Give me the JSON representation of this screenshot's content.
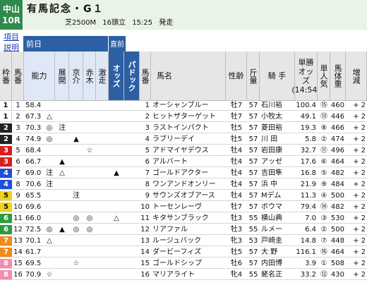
{
  "header": {
    "venue": "中山",
    "race_no": "10R",
    "race_name": "有馬記念・G１",
    "course": "芝2500M",
    "runners": "16頭立",
    "post_time": "15:25",
    "post_label": "発走"
  },
  "side": {
    "items_label": "項目",
    "help_label": "説明"
  },
  "columns": {
    "prev_day": "前日",
    "before": "直前",
    "waku": "枠番",
    "uma": "馬番",
    "nouryoku": "能力",
    "tenkai": "展開",
    "kyou": "京介",
    "akagi": "赤木",
    "gekisou": "激走",
    "odds": "オッズ",
    "paddock": "パドック",
    "uma2": "馬番",
    "horse_name": "馬名",
    "sex_age": "性齢",
    "weight": "斤量",
    "jockey": "騎 手",
    "win_odds": "単勝オッズ",
    "odds_time": "(14:54)",
    "popularity": "単人気",
    "body_weight": "馬体重",
    "change": "増減"
  },
  "rows": [
    {
      "waku": "1",
      "uma": "1",
      "score": "58.4",
      "tenkai": "",
      "kyou": "",
      "akagi": "",
      "gekisou": "",
      "odds_mark": "",
      "paddock": "",
      "name": "オーシャンブルー",
      "sex": "牡7",
      "wt": "57",
      "jockey": "石川裕",
      "odds": "100.4",
      "pop": "⑮",
      "bw": "460",
      "chg": "+ 2"
    },
    {
      "waku": "1",
      "uma": "2",
      "score": "67.3",
      "tenkai": "△",
      "kyou": "",
      "akagi": "",
      "gekisou": "",
      "odds_mark": "",
      "paddock": "",
      "name": "ヒットザターゲット",
      "sex": "牡7",
      "wt": "57",
      "jockey": "小牧太",
      "odds": "49.1",
      "pop": "⑬",
      "bw": "446",
      "chg": "+ 2"
    },
    {
      "waku": "2",
      "uma": "3",
      "score": "70.3",
      "tenkai": "◎",
      "kyou": "注",
      "akagi": "",
      "gekisou": "",
      "odds_mark": "",
      "paddock": "",
      "name": "ラストインパクト",
      "sex": "牡5",
      "wt": "57",
      "jockey": "菱田裕",
      "odds": "19.3",
      "pop": "⑧",
      "bw": "466",
      "chg": "+ 2"
    },
    {
      "waku": "2",
      "uma": "4",
      "score": "74.9",
      "tenkai": "◎",
      "kyou": "",
      "akagi": "▲",
      "gekisou": "",
      "odds_mark": "",
      "paddock": "",
      "name": "ラブリーデイ",
      "sex": "牡5",
      "wt": "57",
      "jockey": "川 田",
      "odds": "5.8",
      "pop": "②",
      "bw": "474",
      "chg": "+ 2"
    },
    {
      "waku": "3",
      "uma": "5",
      "score": "68.4",
      "tenkai": "",
      "kyou": "",
      "akagi": "",
      "gekisou": "☆",
      "odds_mark": "",
      "paddock": "",
      "name": "アドマイヤデウス",
      "sex": "牡4",
      "wt": "57",
      "jockey": "岩田康",
      "odds": "32.7",
      "pop": "⑪",
      "bw": "496",
      "chg": "+ 2"
    },
    {
      "waku": "3",
      "uma": "6",
      "score": "66.7",
      "tenkai": "",
      "kyou": "▲",
      "akagi": "",
      "gekisou": "",
      "odds_mark": "",
      "paddock": "",
      "name": "アルバート",
      "sex": "牡4",
      "wt": "57",
      "jockey": "アッゼ",
      "odds": "17.6",
      "pop": "⑥",
      "bw": "464",
      "chg": "+ 2"
    },
    {
      "waku": "4",
      "uma": "7",
      "score": "69.0",
      "tenkai": "注",
      "kyou": "△",
      "akagi": "",
      "gekisou": "",
      "odds_mark": "▲",
      "paddock": "",
      "name": "ゴールドアクター",
      "sex": "牡4",
      "wt": "57",
      "jockey": "吉田隼",
      "odds": "16.8",
      "pop": "⑤",
      "bw": "482",
      "chg": "+ 2"
    },
    {
      "waku": "4",
      "uma": "8",
      "score": "70.6",
      "tenkai": "注",
      "kyou": "",
      "akagi": "",
      "gekisou": "",
      "odds_mark": "",
      "paddock": "",
      "name": "ワンアンドオンリー",
      "sex": "牡4",
      "wt": "57",
      "jockey": "浜 中",
      "odds": "21.9",
      "pop": "⑨",
      "bw": "484",
      "chg": "+ 2"
    },
    {
      "waku": "5",
      "uma": "9",
      "score": "65.5",
      "tenkai": "",
      "kyou": "",
      "akagi": "注",
      "gekisou": "",
      "odds_mark": "",
      "paddock": "",
      "name": "サウンズオブアース",
      "sex": "牡4",
      "wt": "57",
      "jockey": "Mデム",
      "odds": "11.3",
      "pop": "④",
      "bw": "500",
      "chg": "+ 2"
    },
    {
      "waku": "5",
      "uma": "10",
      "score": "69.6",
      "tenkai": "",
      "kyou": "",
      "akagi": "",
      "gekisou": "",
      "odds_mark": "",
      "paddock": "",
      "name": "トーセンレーヴ",
      "sex": "牡7",
      "wt": "57",
      "jockey": "ボウマ",
      "odds": "79.4",
      "pop": "⑭",
      "bw": "482",
      "chg": "+ 2"
    },
    {
      "waku": "6",
      "uma": "11",
      "score": "66.0",
      "tenkai": "",
      "kyou": "",
      "akagi": "◎",
      "gekisou": "◎",
      "odds_mark": "△",
      "paddock": "",
      "name": "キタサンブラック",
      "sex": "牡3",
      "wt": "55",
      "jockey": "横山典",
      "odds": "7.0",
      "pop": "③",
      "bw": "530",
      "chg": "+ 2"
    },
    {
      "waku": "6",
      "uma": "12",
      "score": "72.5",
      "tenkai": "◎",
      "kyou": "▲",
      "akagi": "◎",
      "gekisou": "◎",
      "odds_mark": "",
      "paddock": "",
      "name": "リアファル",
      "sex": "牡3",
      "wt": "55",
      "jockey": "ルメー",
      "odds": "6.4",
      "pop": "②",
      "bw": "500",
      "chg": "+ 2"
    },
    {
      "waku": "7",
      "uma": "13",
      "score": "70.1",
      "tenkai": "△",
      "kyou": "",
      "akagi": "",
      "gekisou": "",
      "odds_mark": "",
      "paddock": "",
      "name": "ルージュバック",
      "sex": "牝3",
      "wt": "53",
      "jockey": "戸崎圭",
      "odds": "14.8",
      "pop": "⑦",
      "bw": "448",
      "chg": "+ 2"
    },
    {
      "waku": "7",
      "uma": "14",
      "score": "61.7",
      "tenkai": "",
      "kyou": "",
      "akagi": "",
      "gekisou": "",
      "odds_mark": "",
      "paddock": "",
      "name": "ダービーフィズ",
      "sex": "牡5",
      "wt": "57",
      "jockey": "大 野",
      "odds": "116.1",
      "pop": "⑯",
      "bw": "464",
      "chg": "+ 2"
    },
    {
      "waku": "8",
      "uma": "15",
      "score": "69.5",
      "tenkai": "",
      "kyou": "",
      "akagi": "☆",
      "gekisou": "",
      "odds_mark": "",
      "paddock": "",
      "name": "ゴールドシップ",
      "sex": "牡6",
      "wt": "57",
      "jockey": "内田博",
      "odds": "3.9",
      "pop": "①",
      "bw": "508",
      "chg": "+ 2"
    },
    {
      "waku": "8",
      "uma": "16",
      "score": "70.9",
      "tenkai": "☆",
      "kyou": "",
      "akagi": "",
      "gekisou": "",
      "odds_mark": "",
      "paddock": "",
      "name": "マリアライト",
      "sex": "牝4",
      "wt": "55",
      "jockey": "蛯名正",
      "odds": "33.2",
      "pop": "⑫",
      "bw": "430",
      "chg": "+ 2"
    }
  ]
}
